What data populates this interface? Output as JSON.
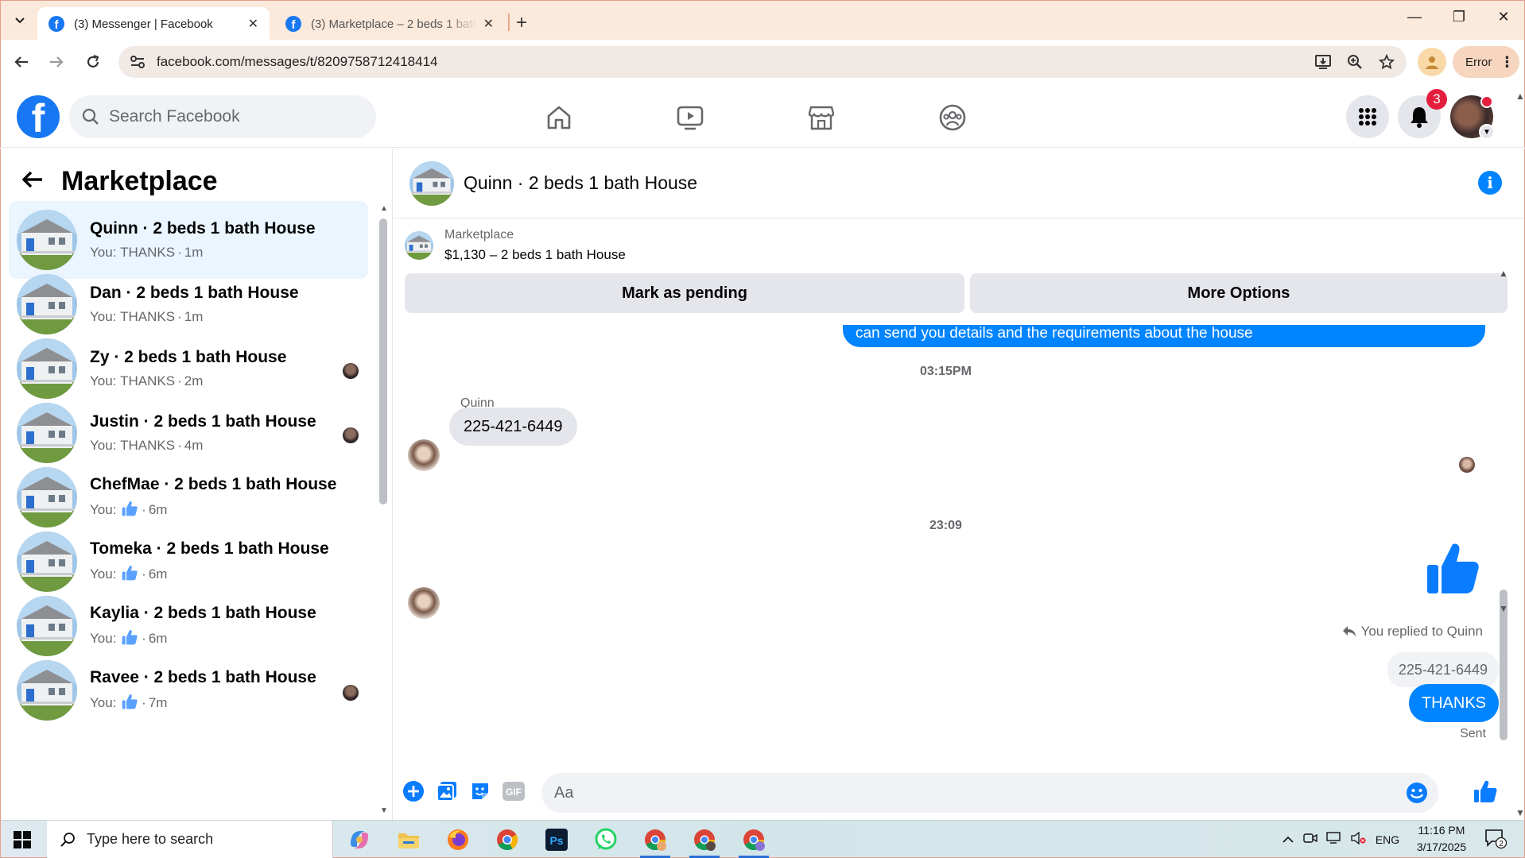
{
  "browser": {
    "tabs": [
      {
        "title": "(3) Messenger | Facebook",
        "active": true
      },
      {
        "title": "(3) Marketplace – 2 beds 1 bath",
        "active": false
      }
    ],
    "url": "facebook.com/messages/t/8209758712418414",
    "error_chip": "Error"
  },
  "fb": {
    "search_placeholder": "Search Facebook",
    "notification_count": "3",
    "brand_color": "#1877f2"
  },
  "sidebar": {
    "title": "Marketplace",
    "conversations": [
      {
        "name": "Quinn · 2 beds 1 bath House",
        "prefix": "You: ",
        "message": "THANKS",
        "time": "1m",
        "like": false,
        "selected": true,
        "read_avatar": false
      },
      {
        "name": "Dan · 2 beds 1 bath House",
        "prefix": "You: ",
        "message": "THANKS",
        "time": "1m",
        "like": false,
        "selected": false,
        "read_avatar": false
      },
      {
        "name": "Zy · 2 beds 1 bath House",
        "prefix": "You: ",
        "message": "THANKS",
        "time": "2m",
        "like": false,
        "selected": false,
        "read_avatar": true
      },
      {
        "name": "Justin · 2 beds 1 bath House",
        "prefix": "You: ",
        "message": "THANKS",
        "time": "4m",
        "like": false,
        "selected": false,
        "read_avatar": true
      },
      {
        "name": "ChefMae · 2 beds 1 bath House",
        "prefix": "You: ",
        "message": "",
        "time": "6m",
        "like": true,
        "selected": false,
        "read_avatar": false
      },
      {
        "name": "Tomeka · 2 beds 1 bath House",
        "prefix": "You: ",
        "message": "",
        "time": "6m",
        "like": true,
        "selected": false,
        "read_avatar": false
      },
      {
        "name": "Kaylia · 2 beds 1 bath House",
        "prefix": "You: ",
        "message": "",
        "time": "6m",
        "like": true,
        "selected": false,
        "read_avatar": false
      },
      {
        "name": "Ravee · 2 beds 1 bath House",
        "prefix": "You: ",
        "message": "",
        "time": "7m",
        "like": true,
        "selected": false,
        "read_avatar": true
      }
    ]
  },
  "chat": {
    "title": "Quinn · 2 beds 1 bath House",
    "listing": {
      "source": "Marketplace",
      "price_line": "$1,130 – 2 beds 1 bath House"
    },
    "actions": {
      "pending": "Mark as pending",
      "more": "More Options"
    },
    "messages": {
      "outgoing_partial": "can send you details and the requirements about the house",
      "timestamp_1": "03:15PM",
      "sender": "Quinn",
      "incoming": "225-421-6449",
      "timestamp_2": "23:09",
      "replied_label": "You replied to Quinn",
      "quoted": "225-421-6449",
      "outgoing": "THANKS",
      "status": "Sent"
    },
    "composer_placeholder": "Aa"
  },
  "taskbar": {
    "search_placeholder": "Type here to search",
    "language": "ENG",
    "time": "11:16 PM",
    "date": "3/17/2025",
    "notification_count": "2"
  }
}
